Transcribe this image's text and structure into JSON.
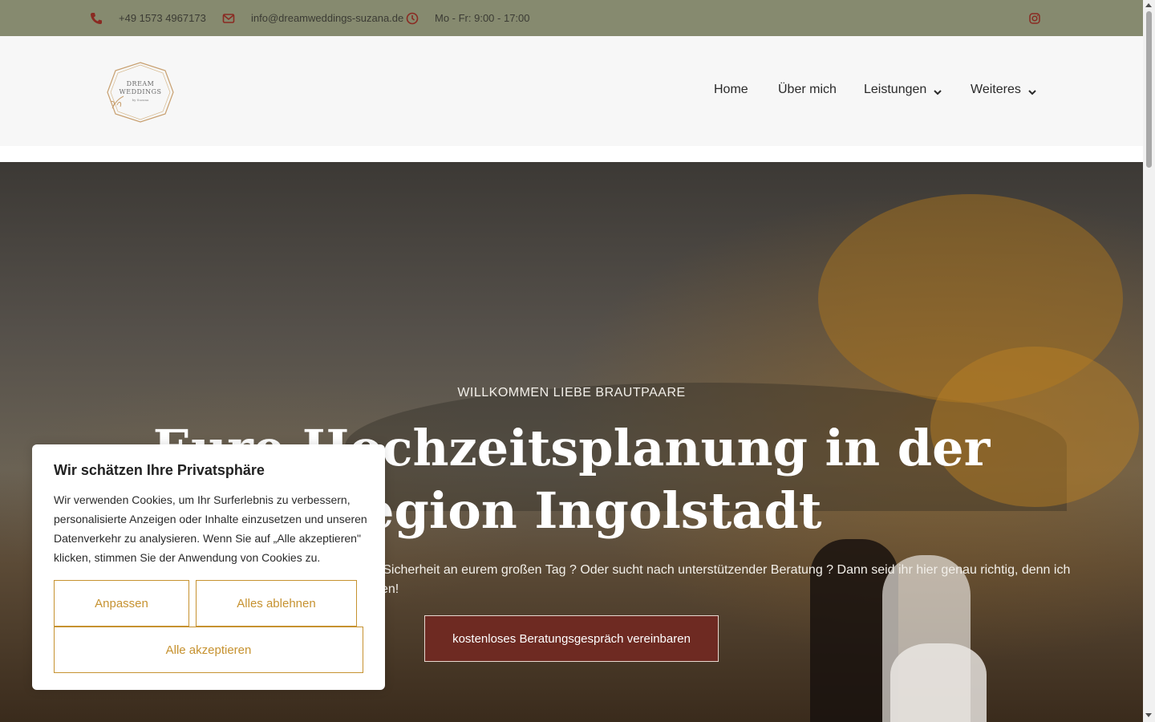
{
  "topbar": {
    "phone": "+49 1573 4967173",
    "email": "info@dreamweddings-suzana.de",
    "hours": "Mo - Fr: 9:00 - 17:00",
    "icons": [
      "phone-icon",
      "mail-icon",
      "clock-icon",
      "instagram-icon"
    ]
  },
  "header": {
    "logo_lines": [
      "DREAM",
      "WEDDINGS",
      "by Suzana"
    ],
    "nav": [
      "Home",
      "Über mich",
      "Leistungen",
      "Weiteres"
    ]
  },
  "hero": {
    "subtitle": "WILLKOMMEN LIEBE BRAUTPAARE",
    "title": "Eure Hochzeitsplanung in der Region Ingolstadt",
    "text_visible": "nd Sicherheit an eurem großen Tag ? Oder sucht nach unterstützender Beratung ? Dann seid ihr hier genau richtig, denn ich",
    "text_visible_line2": "en!",
    "cta": "kostenloses Beratungsgespräch vereinbaren"
  },
  "cookie": {
    "title": "Wir schätzen Ihre Privatsphäre",
    "text": "Wir verwenden Cookies, um Ihr Surferlebnis zu verbessern, personalisierte Anzeigen oder Inhalte einzusetzen und unseren Datenverkehr zu analysieren. Wenn Sie auf „Alle akzeptieren\" klicken, stimmen Sie der Anwendung von Cookies zu.",
    "customize": "Anpassen",
    "reject": "Alles ablehnen",
    "accept": "Alle akzeptieren"
  },
  "colors": {
    "topbar_bg": "#868a6f",
    "accent_icon": "#8a2a22",
    "cta_bg": "#6e2a22",
    "cookie_accent": "#c69230"
  }
}
